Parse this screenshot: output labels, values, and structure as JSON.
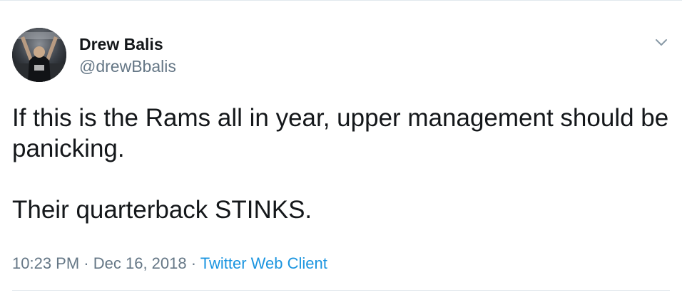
{
  "tweet": {
    "author_name": "Drew Balis",
    "author_handle": "@drewBbalis",
    "text": "If this is the Rams all in year, upper management should be panicking.\n\nTheir quarterback STINKS.",
    "time": "10:23 PM",
    "separator": " · ",
    "date": "Dec 16, 2018",
    "source": "Twitter Web Client"
  },
  "icons": {
    "more": "chevron-down-icon",
    "avatar": "avatar"
  },
  "colors": {
    "text": "#14171a",
    "secondary": "#657786",
    "link": "#1b95e0",
    "divider": "#e1e8ed"
  }
}
